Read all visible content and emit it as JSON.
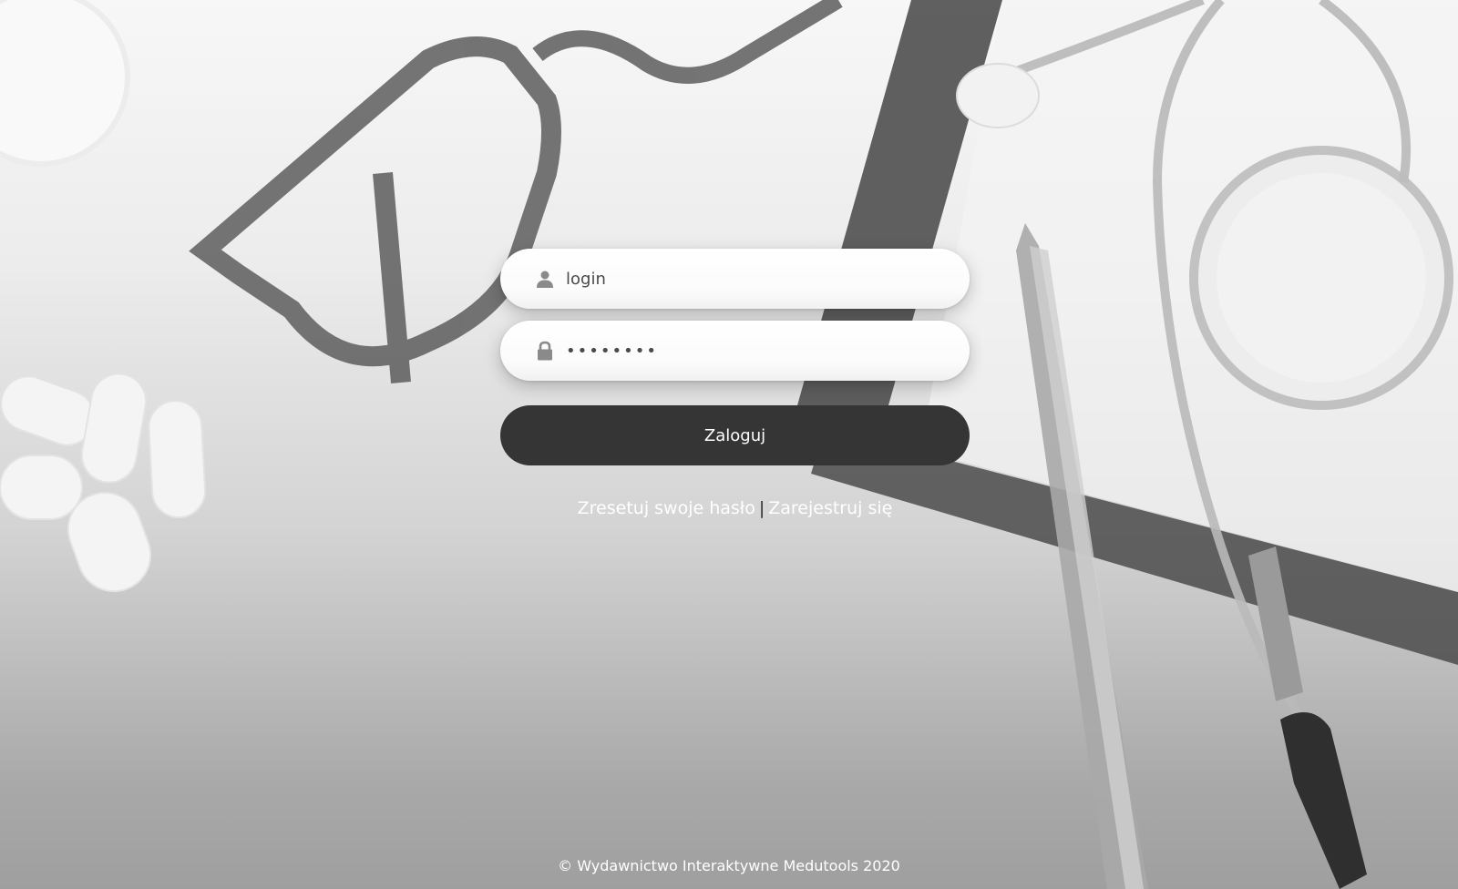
{
  "login_form": {
    "login_placeholder": "login",
    "password_value": "••••••••",
    "login_icon": "user-icon",
    "password_icon": "lock-icon",
    "submit_label": "Zaloguj"
  },
  "links": {
    "reset_password": "Zresetuj swoje hasło",
    "separator": "|",
    "register": "Zarejestruj się"
  },
  "footer": {
    "copyright": "© Wydawnictwo Interaktywne Medutools 2020"
  },
  "colors": {
    "button_bg": "#353535",
    "field_bg": "#ffffff",
    "link_text": "#ffffff"
  }
}
